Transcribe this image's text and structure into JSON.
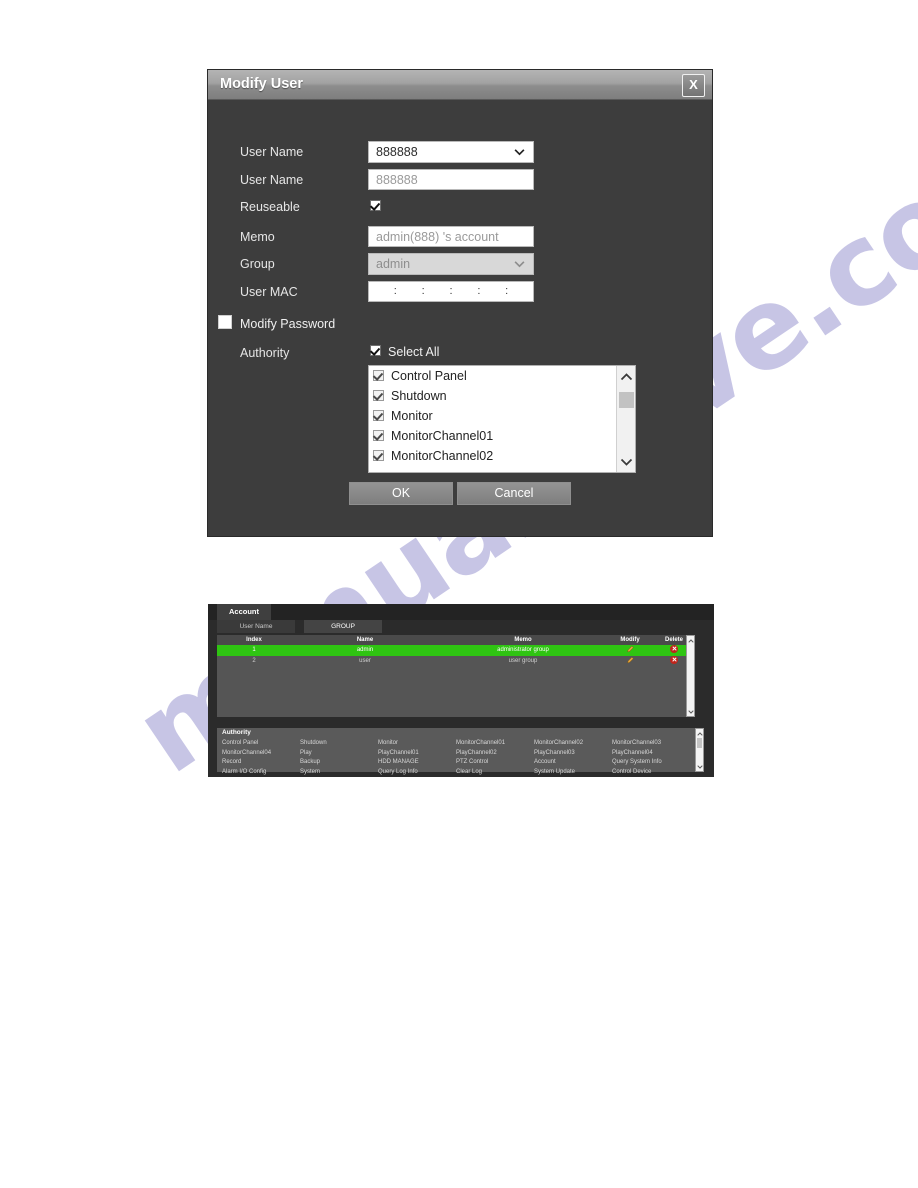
{
  "watermark": {
    "text": "manualshive.com"
  },
  "dialog": {
    "title": "Modify User",
    "close_label": "X",
    "fields": {
      "user_name_select_label": "User Name",
      "user_name_select_value": "888888",
      "user_name_input_label": "User Name",
      "user_name_input_value": "888888",
      "reuseable_label": "Reuseable",
      "memo_label": "Memo",
      "memo_value": "admin(888) 's account",
      "group_label": "Group",
      "group_value": "admin",
      "user_mac_label": "User MAC",
      "mac_separator": ":",
      "modify_password_label": "Modify Password",
      "authority_label": "Authority",
      "select_all_label": "Select All"
    },
    "authority_items": [
      {
        "label": "Control Panel",
        "checked": true
      },
      {
        "label": "Shutdown",
        "checked": true
      },
      {
        "label": "Monitor",
        "checked": true
      },
      {
        "label": "MonitorChannel01",
        "checked": true
      },
      {
        "label": "MonitorChannel02",
        "checked": true
      }
    ],
    "buttons": {
      "ok": "OK",
      "cancel": "Cancel"
    }
  },
  "account_panel": {
    "main_tab": "Account",
    "sub_tabs": [
      {
        "label": "User Name",
        "active": false
      },
      {
        "label": "GROUP",
        "active": true
      }
    ],
    "table": {
      "headers": [
        "Index",
        "Name",
        "Memo",
        "Modify",
        "Delete"
      ],
      "rows": [
        {
          "index": "1",
          "name": "admin",
          "memo": "administrator group",
          "selected": true
        },
        {
          "index": "2",
          "name": "user",
          "memo": "user group",
          "selected": false
        }
      ]
    },
    "authority": {
      "title": "Authority",
      "items": [
        "Control Panel",
        "Shutdown",
        "Monitor",
        "MonitorChannel01",
        "MonitorChannel02",
        "MonitorChannel03",
        "MonitorChannel04",
        "Play",
        "PlayChannel01",
        "PlayChannel02",
        "PlayChannel03",
        "PlayChannel04",
        "Record",
        "Backup",
        "HDD MANAGE",
        "PTZ Control",
        "Account",
        "Query System Info",
        "Alarm I/O Config",
        "System",
        "Query Log Info",
        "Clear Log",
        "System Update",
        "Control Device"
      ]
    }
  }
}
